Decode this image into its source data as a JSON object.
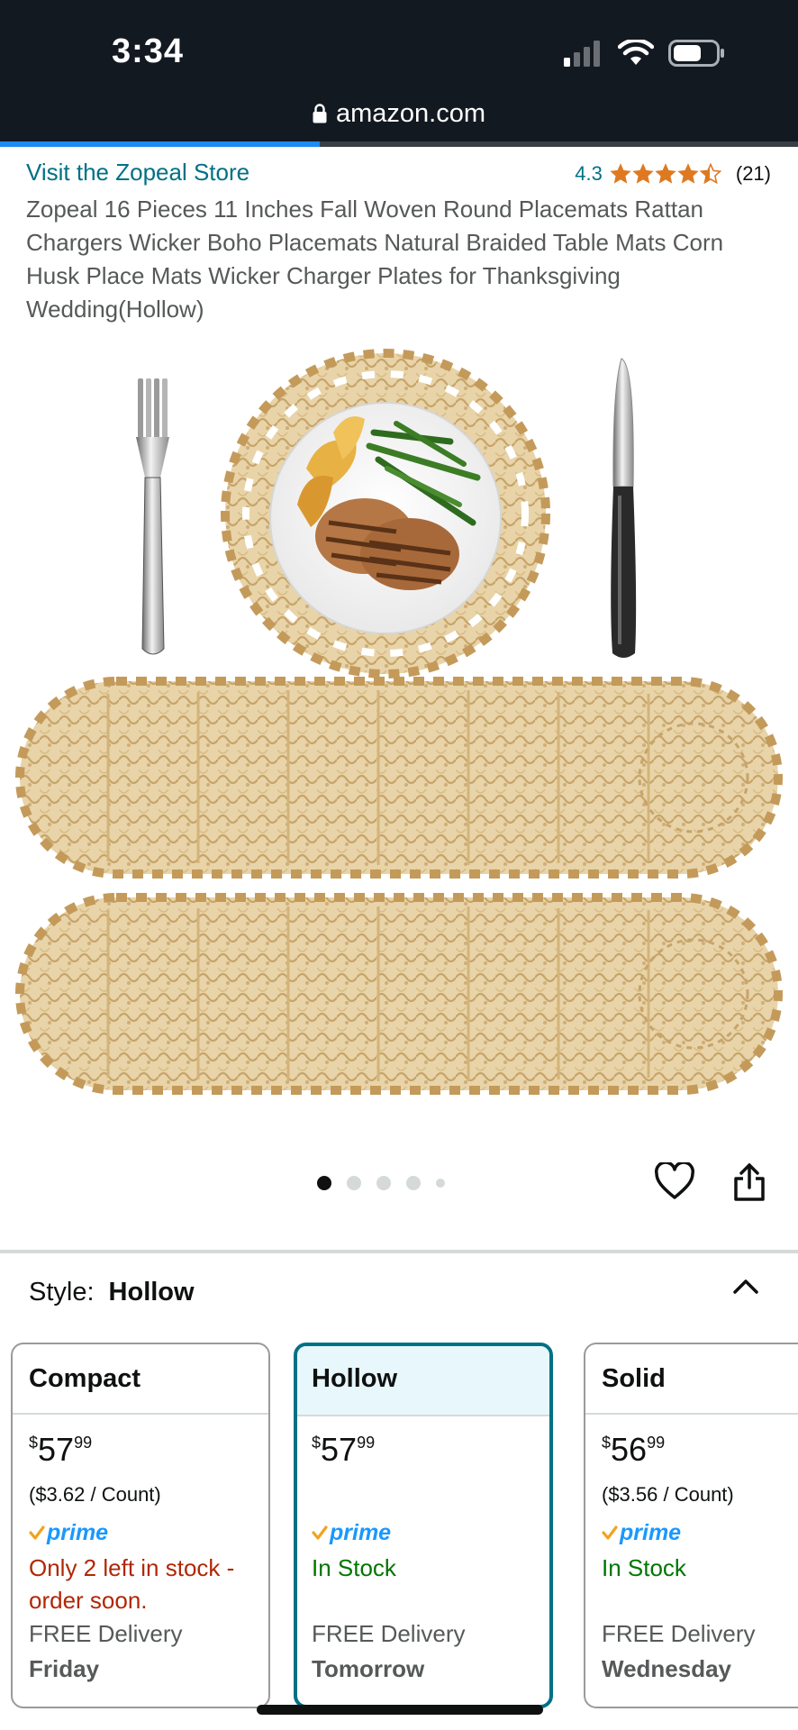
{
  "status_bar": {
    "time": "3:34"
  },
  "browser": {
    "url": "amazon.com"
  },
  "store": {
    "link_label": "Visit the Zopeal Store"
  },
  "rating": {
    "value": "4.3",
    "count": "(21)",
    "stars_filled": 4.3
  },
  "product": {
    "title": "Zopeal 16 Pieces 11 Inches Fall Woven Round Placemats Rattan Chargers Wicker Boho Placemats Natural Braided Table Mats Corn Husk Place Mats Wicker Charger Plates for Thanksgiving Wedding(Hollow)"
  },
  "gallery": {
    "image_count": 5,
    "current_index": 1
  },
  "style": {
    "label": "Style:",
    "selected": "Hollow"
  },
  "options": [
    {
      "name": "Compact",
      "currency": "$",
      "price_whole": "57",
      "price_cents": "99",
      "unit_price": "($3.62 / Count)",
      "prime": "prime",
      "stock": "Only 2 left in stock - order soon.",
      "stock_status": "low",
      "delivery_label": "FREE Delivery",
      "delivery_day": "Friday"
    },
    {
      "name": "Hollow",
      "currency": "$",
      "price_whole": "57",
      "price_cents": "99",
      "unit_price": "",
      "prime": "prime",
      "stock": "In Stock",
      "stock_status": "in",
      "delivery_label": "FREE Delivery",
      "delivery_day": "Tomorrow"
    },
    {
      "name": "Solid",
      "currency": "$",
      "price_whole": "56",
      "price_cents": "99",
      "unit_price": "($3.56 / Count)",
      "prime": "prime",
      "stock": "In Stock",
      "stock_status": "in",
      "delivery_label": "FREE Delivery",
      "delivery_day": "Wednesday"
    }
  ],
  "colors": {
    "link": "#007185",
    "star": "#de7921",
    "prime_blue": "#1a98ff",
    "prime_check": "#f0a41e",
    "in_stock": "#007600",
    "low_stock": "#b12704",
    "header_bg": "#131921",
    "selected_border": "#007185"
  }
}
